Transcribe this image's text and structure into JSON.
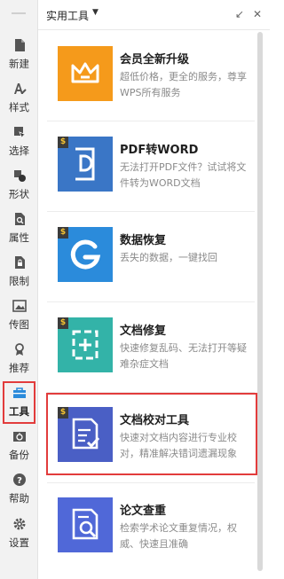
{
  "header": {
    "title": "实用工具"
  },
  "sidebar": {
    "items": [
      {
        "label": "新建",
        "icon": "new-file-icon"
      },
      {
        "label": "样式",
        "icon": "style-icon"
      },
      {
        "label": "选择",
        "icon": "select-icon"
      },
      {
        "label": "形状",
        "icon": "shape-icon"
      },
      {
        "label": "属性",
        "icon": "properties-icon"
      },
      {
        "label": "限制",
        "icon": "lock-file-icon"
      },
      {
        "label": "传图",
        "icon": "image-upload-icon"
      },
      {
        "label": "推荐",
        "icon": "recommend-icon"
      },
      {
        "label": "工具",
        "icon": "toolbox-icon"
      },
      {
        "label": "备份",
        "icon": "backup-icon"
      },
      {
        "label": "帮助",
        "icon": "help-icon"
      },
      {
        "label": "设置",
        "icon": "settings-icon"
      }
    ]
  },
  "tools": [
    {
      "title": "会员全新升级",
      "desc": "超低价格，更全的服务，尊享WPS所有服务",
      "icon": "crown-icon",
      "color": "#f59a1b",
      "badge": ""
    },
    {
      "title": "PDF转WORD",
      "desc": "无法打开PDF文件？试试将文件转为WORD文档",
      "icon": "pdf-to-word-icon",
      "color": "#3a76c6",
      "badge": "$"
    },
    {
      "title": "数据恢复",
      "desc": "丢失的数据，一键找回",
      "icon": "data-recovery-icon",
      "color": "#2b8bdb",
      "badge": "$"
    },
    {
      "title": "文档修复",
      "desc": "快速修复乱码、无法打开等疑难杂症文档",
      "icon": "doc-repair-icon",
      "color": "#33b3a8",
      "badge": "$"
    },
    {
      "title": "文档校对工具",
      "desc": "快速对文档内容进行专业校对，精准解决错词遗漏现象",
      "icon": "doc-proofread-icon",
      "color": "#4a5fc5",
      "badge": "$"
    },
    {
      "title": "论文查重",
      "desc": "检索学术论文重复情况，权威、快速且准确",
      "icon": "paper-check-icon",
      "color": "#5068d8",
      "badge": ""
    }
  ]
}
